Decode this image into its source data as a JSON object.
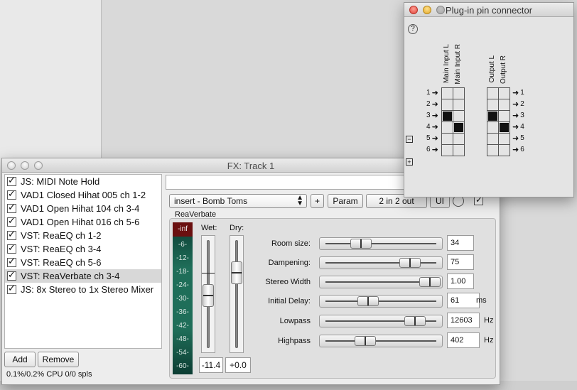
{
  "fx_window": {
    "title": "FX: Track 1",
    "fx_list": [
      {
        "label": "JS: MIDI Note Hold",
        "checked": true
      },
      {
        "label": "VAD1 Closed Hihat 005 ch 1-2",
        "checked": true
      },
      {
        "label": "VAD1 Open Hihat 104 ch 3-4",
        "checked": true
      },
      {
        "label": "VAD1 Open Hihat 016 ch 5-6",
        "checked": true
      },
      {
        "label": "VST: ReaEQ ch 1-2",
        "checked": true
      },
      {
        "label": "VST: ReaEQ ch 3-4",
        "checked": true
      },
      {
        "label": "VST: ReaEQ ch 5-6",
        "checked": true
      },
      {
        "label": "VST: ReaVerbate ch 3-4",
        "checked": true,
        "selected": true
      },
      {
        "label": "JS: 8x Stereo to 1x Stereo Mixer",
        "checked": true
      }
    ],
    "add_label": "Add",
    "remove_label": "Remove",
    "cpu_status": "0.1%/0.2% CPU 0/0 spls",
    "preset": "insert - Bomb Toms",
    "plus_label": "+",
    "param_label": "Param",
    "io_label": "2 in 2 out",
    "ui_label": "UI",
    "plugin_name": "ReaVerbate",
    "meter": {
      "clip_label": "-inf",
      "ticks": [
        "-6-",
        "-12-",
        "-18-",
        "-24-",
        "-30-",
        "-36-",
        "-42-",
        "-48-",
        "-54-",
        "-60-"
      ]
    },
    "wet": {
      "label": "Wet:",
      "value": "-11.4"
    },
    "dry": {
      "label": "Dry:",
      "value": "+0.0"
    },
    "params": [
      {
        "label": "Room size:",
        "value": "34",
        "unit": "",
        "level": 0.3
      },
      {
        "label": "Dampening:",
        "value": "75",
        "unit": "",
        "level": 0.8
      },
      {
        "label": "Stereo Width",
        "value": "1.00",
        "unit": "",
        "level": 1.0
      },
      {
        "label": "Initial Delay:",
        "value": "61",
        "unit": "ms",
        "level": 0.37
      },
      {
        "label": "Lowpass",
        "value": "12603",
        "unit": "Hz",
        "level": 0.85
      },
      {
        "label": "Highpass",
        "value": "402",
        "unit": "Hz",
        "level": 0.34
      }
    ]
  },
  "pin_window": {
    "title": "Plug-in pin connector",
    "help_label": "?",
    "input_labels": [
      "Main Input L",
      "Main Input R"
    ],
    "output_labels": [
      "Output L",
      "Output R"
    ],
    "pin_numbers": [
      "1",
      "2",
      "3",
      "4",
      "5",
      "6"
    ],
    "minus_label": "−",
    "plus_label": "+",
    "input_grid": [
      [
        0,
        0
      ],
      [
        0,
        0
      ],
      [
        1,
        0
      ],
      [
        0,
        1
      ],
      [
        0,
        0
      ],
      [
        0,
        0
      ]
    ],
    "output_grid": [
      [
        0,
        0
      ],
      [
        0,
        0
      ],
      [
        1,
        0
      ],
      [
        0,
        1
      ],
      [
        0,
        0
      ],
      [
        0,
        0
      ]
    ]
  }
}
